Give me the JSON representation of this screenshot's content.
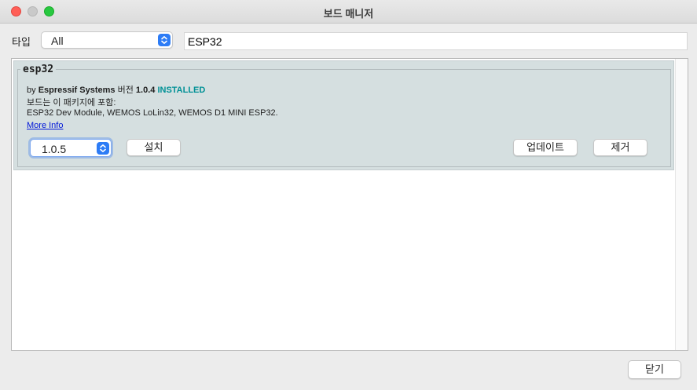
{
  "window": {
    "title": "보드 매니저"
  },
  "filter": {
    "type_label": "타입",
    "type_value": "All",
    "search_value": "ESP32"
  },
  "package": {
    "name": "esp32",
    "by": "by",
    "author": "Espressif Systems",
    "version_word": "버전",
    "version": "1.0.4",
    "status": "INSTALLED",
    "includes_label": "보드는 이 패키지에 포함:",
    "boards": "ESP32 Dev Module, WEMOS LoLin32, WEMOS D1 MINI ESP32.",
    "more_info": "More Info",
    "selected_version": "1.0.5",
    "install_label": "설치",
    "update_label": "업데이트",
    "remove_label": "제거"
  },
  "footer": {
    "close_label": "닫기"
  },
  "colors": {
    "installed": "#009196",
    "link": "#0016d8",
    "card_bg": "#d5dfe0",
    "accent": "#2d7cf6"
  }
}
